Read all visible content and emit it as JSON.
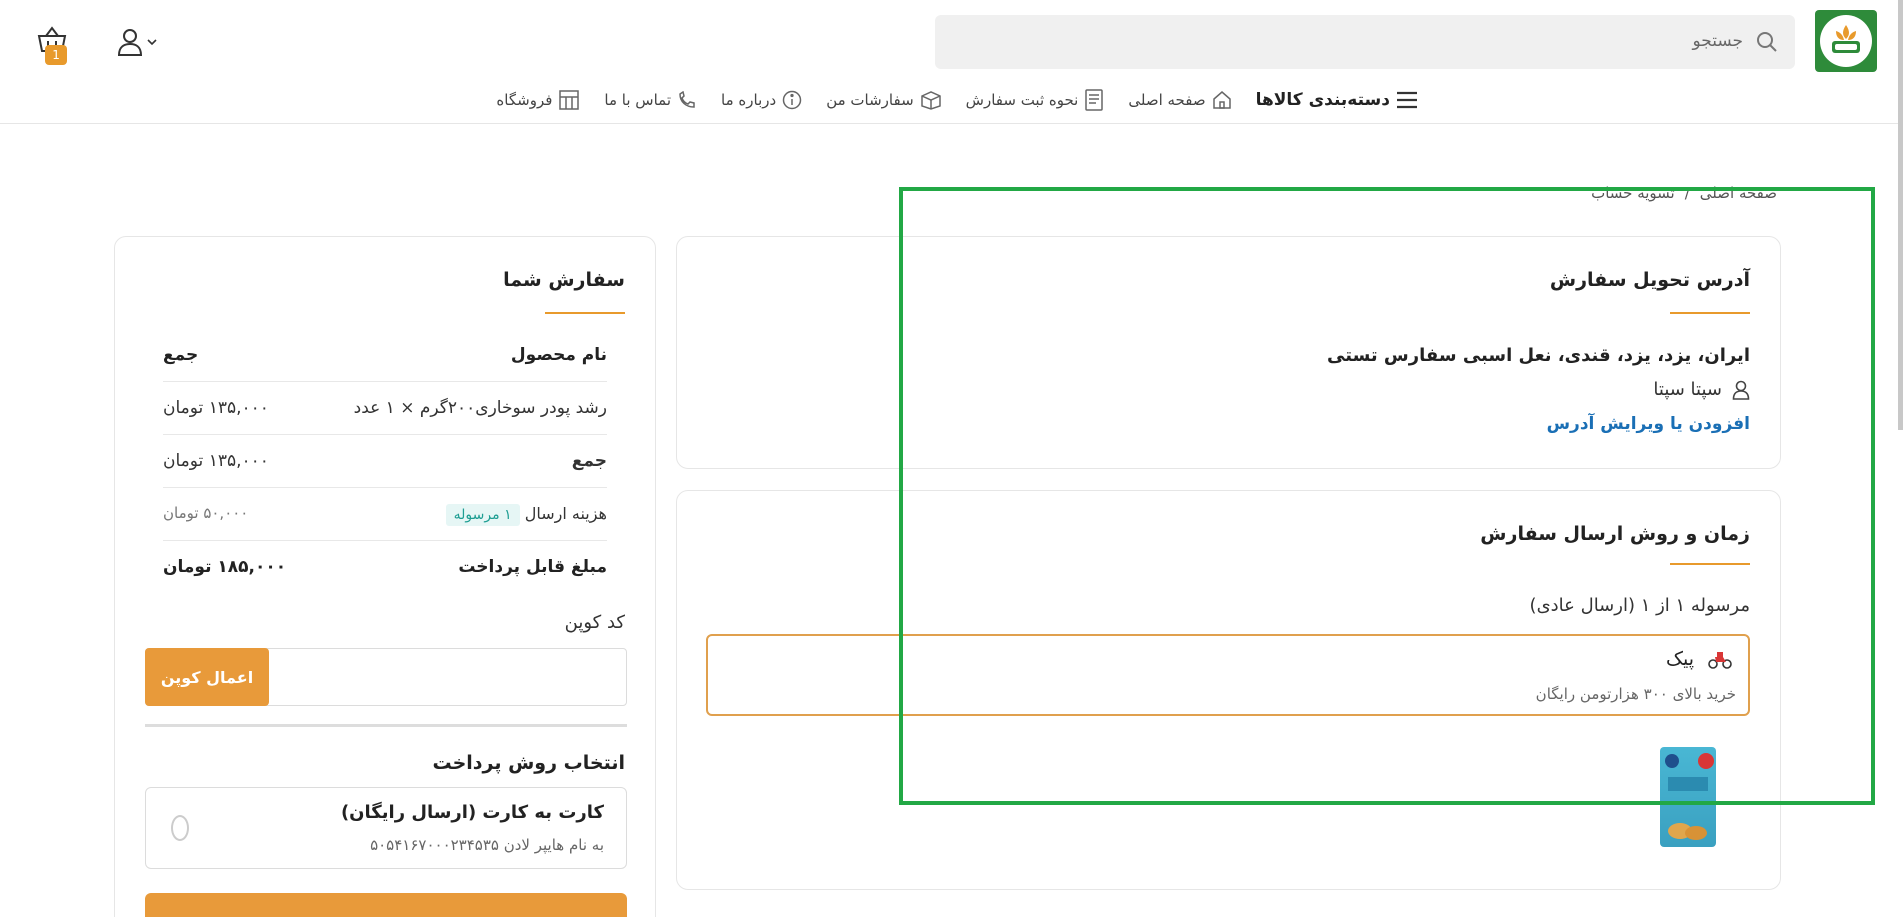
{
  "header": {
    "search_placeholder": "جستجو",
    "cart_count": "1"
  },
  "nav": {
    "categories": "دسته‌بندی کالاها",
    "home": "صفحه اصلی",
    "how_to_order": "نحوه ثبت سفارش",
    "my_orders": "سفارشات من",
    "about": "درباره ما",
    "contact": "تماس با ما",
    "store": "فروشگاه"
  },
  "breadcrumb": {
    "home": "صفحه اصلی",
    "sep": "/",
    "current": "تسویه حساب"
  },
  "address": {
    "title": "آدرس تحویل سفارش",
    "line": "ایران، یزد، یزد، قندی، نعل اسبی سفارس تستی",
    "name": "سپتا سپتا",
    "edit_link": "افزودن یا ویرایش آدرس"
  },
  "shipping": {
    "title": "زمان و روش ارسال سفارش",
    "subtitle": "مرسوله ۱ از ۱ (ارسال عادی)",
    "option_name": "پیک",
    "option_desc": "خرید بالای ۳۰۰ هزارتومن رایگان"
  },
  "order": {
    "title": "سفارش شما",
    "header_product": "نام محصول",
    "header_total": "جمع",
    "item_name": "رشد پودر سوخاری۲۰۰گرم × ۱ عدد",
    "item_price": "۱۳۵,۰۰۰ تومان",
    "subtotal_label": "جمع",
    "subtotal_value": "۱۳۵,۰۰۰ تومان",
    "shipping_label": "هزینه ارسال",
    "shipping_badge": "۱ مرسوله",
    "shipping_value": "۵۰,۰۰۰ تومان",
    "payable_label": "مبلغ قابل پرداخت",
    "payable_value": "۱۸۵,۰۰۰ تومان",
    "coupon_label": "کد کوپن",
    "coupon_button": "اعمال کوپن",
    "payment_title": "انتخاب روش پرداخت",
    "payment_name": "کارت به کارت (ارسال رایگان)",
    "payment_desc": "به نام هایپر لادن ۵۰۵۴۱۶۷۰۰۰۲۳۴۵۳۵"
  },
  "colors": {
    "accent": "#e89a3a",
    "link": "#1a6fb5",
    "highlight_box": "#22a845"
  }
}
